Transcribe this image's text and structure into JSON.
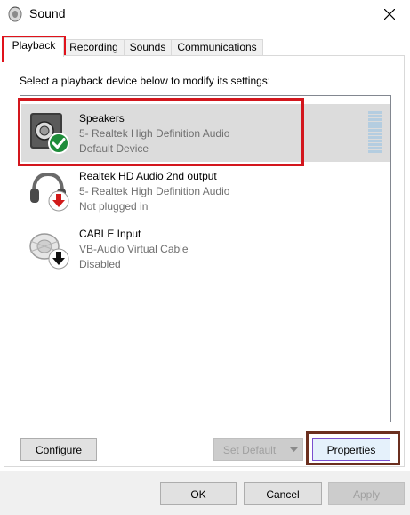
{
  "window": {
    "title": "Sound",
    "icons": {
      "app": "speaker-sound-icon",
      "close": "close-icon"
    }
  },
  "tabs": [
    {
      "label": "Playback",
      "active": true
    },
    {
      "label": "Recording",
      "active": false
    },
    {
      "label": "Sounds",
      "active": false
    },
    {
      "label": "Communications",
      "active": false
    }
  ],
  "instruction": "Select a playback device below to modify its settings:",
  "devices": [
    {
      "name": "Speakers",
      "driver": "5- Realtek High Definition Audio",
      "status": "Default Device",
      "icon": "speaker-icon",
      "badge": "check-badge-icon",
      "selected": true
    },
    {
      "name": "Realtek HD Audio 2nd output",
      "driver": "5- Realtek High Definition Audio",
      "status": "Not plugged in",
      "icon": "headphones-icon",
      "badge": "red-down-arrow-icon",
      "selected": false
    },
    {
      "name": "CABLE Input",
      "driver": "VB-Audio Virtual Cable",
      "status": "Disabled",
      "icon": "speaker-cable-icon",
      "badge": "black-down-arrow-icon",
      "selected": false
    }
  ],
  "buttons": {
    "configure": "Configure",
    "set_default": "Set Default",
    "properties": "Properties",
    "ok": "OK",
    "cancel": "Cancel",
    "apply": "Apply"
  },
  "colors": {
    "highlight_red": "#d3161d",
    "highlight_brown": "#6b2f1f",
    "selection": "#dcdcdc",
    "check_green": "#1e8c3a",
    "arrow_red": "#d11a1a"
  }
}
